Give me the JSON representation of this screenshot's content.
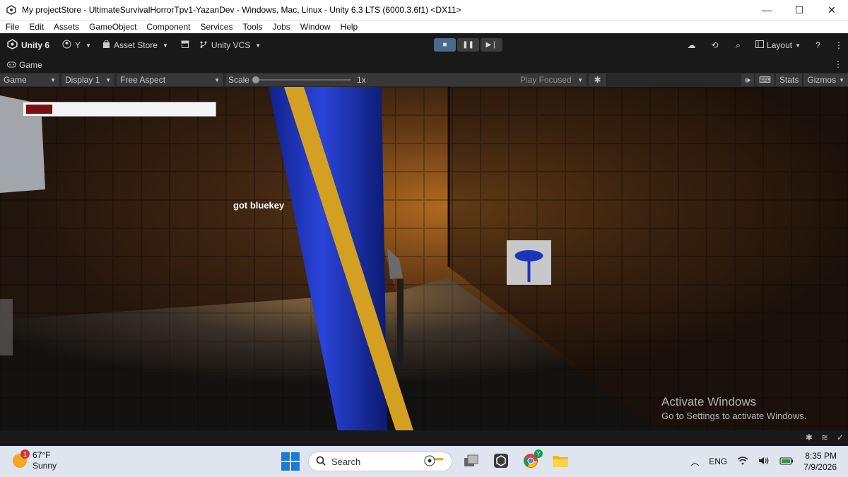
{
  "window": {
    "title": "My projectStore - UltimateSurvivalHorrorTpv1-YazanDev - Windows, Mac, Linux - Unity 6.3 LTS (6000.3.6f1) <DX11>",
    "minimize": "—",
    "maximize": "☐",
    "close": "✕"
  },
  "menu": [
    "File",
    "Edit",
    "Assets",
    "GameObject",
    "Component",
    "Services",
    "Tools",
    "Jobs",
    "Window",
    "Help"
  ],
  "toolbar": {
    "unity_label": "Unity 6",
    "account_label": "Y",
    "asset_store_label": "Asset Store",
    "vcs_label": "Unity VCS",
    "layout_label": "Layout"
  },
  "game_tab": {
    "label": "Game"
  },
  "game_controls": {
    "view_select": "Game",
    "display_select": "Display 1",
    "aspect_select": "Free Aspect",
    "scale_label": "Scale",
    "scale_value": "1x",
    "play_mode_select": "Play Focused",
    "stats_label": "Stats",
    "gizmos_label": "Gizmos"
  },
  "hud": {
    "health_fraction": 0.14,
    "pickup_message": "got bluekey"
  },
  "watermark": {
    "title": "Activate Windows",
    "subtitle": "Go to Settings to activate Windows."
  },
  "taskbar": {
    "weather_badge": "1",
    "temperature": "67°F",
    "condition": "Sunny",
    "search_placeholder": "Search",
    "chrome_badge": "Y",
    "language": "ENG",
    "time": "8:35 PM",
    "date": "7/9/2026"
  },
  "colors": {
    "unity_dark": "#191919",
    "toolbar_field": "#383838",
    "health_fill": "#7a0f0f",
    "key_blue": "#1a35b8",
    "taskbar_bg": "#dfe5ee"
  }
}
